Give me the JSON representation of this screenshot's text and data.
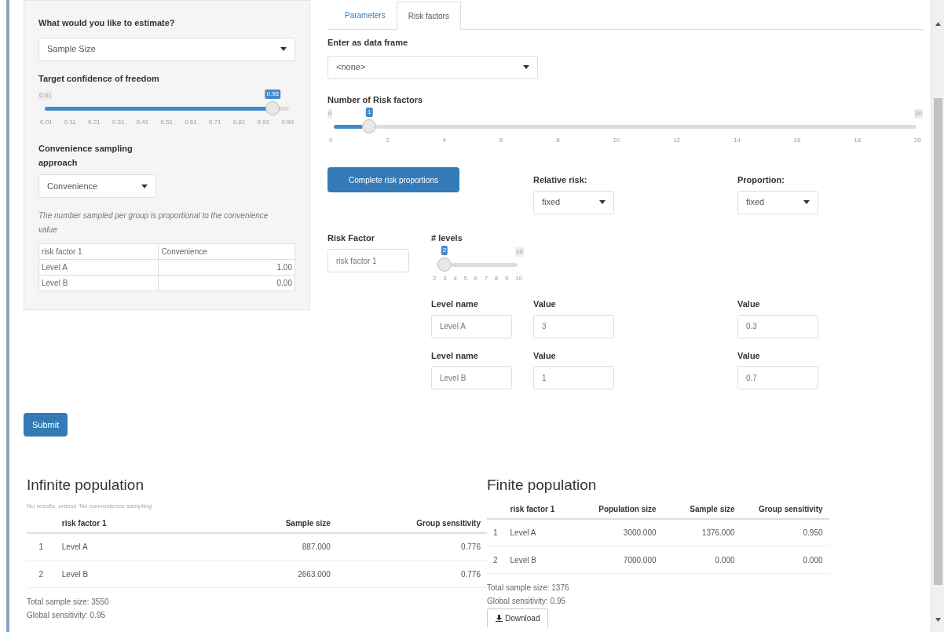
{
  "sidebar": {
    "estimate": {
      "label": "What would you like to estimate?",
      "value": "Sample Size"
    },
    "confidence": {
      "label": "Target confidence of freedom",
      "min_label": "0.01",
      "value_label": "0.95",
      "level": 0.96,
      "ticks": [
        "0.01",
        "0.11",
        "0.21",
        "0.31",
        "0.41",
        "0.51",
        "0.61",
        "0.71",
        "0.81",
        "0.91",
        "0.99"
      ]
    },
    "approach": {
      "label": "Convenience sampling approach",
      "value": "Convenience"
    },
    "note": "The number sampled per group is proportional to the convenience value",
    "table": {
      "columns": [
        "risk factor 1",
        "Convenience"
      ],
      "rows": [
        [
          "Level A",
          "1.00"
        ],
        [
          "Level B",
          "0.00"
        ]
      ]
    }
  },
  "tabs": [
    {
      "label": "Parameters",
      "selected": false
    },
    {
      "label": "Risk factors",
      "selected": true
    }
  ],
  "risk": {
    "frame": {
      "label": "Enter as data frame",
      "value": "<none>"
    },
    "count": {
      "label": "Number of Risk factors",
      "min_label": "0",
      "value_label": "1",
      "max_label": "20",
      "level": 0.05,
      "ticks": [
        "0",
        "2",
        "4",
        "6",
        "8",
        "10",
        "12",
        "14",
        "16",
        "18",
        "20"
      ]
    },
    "complete_button": "Complete risk proportions",
    "relative": {
      "label": "Relative risk:",
      "value": "fixed"
    },
    "proportion": {
      "label": "Proportion:",
      "value": "fixed"
    },
    "factor": {
      "label": "Risk Factor",
      "value": "risk factor 1"
    },
    "levels_slider": {
      "label": "# levels",
      "value_label": "2",
      "max_label": "10",
      "level": 0,
      "ticks": [
        "2",
        "3",
        "4",
        "5",
        "6",
        "7",
        "8",
        "9",
        "10"
      ]
    },
    "levels": [
      {
        "name_label": "Level name",
        "name": "Level A",
        "value_label": "Value",
        "value": "3",
        "proportion_label": "Value",
        "proportion": "0.3"
      },
      {
        "name_label": "Level name",
        "name": "Level B",
        "value_label": "Value",
        "value": "1",
        "proportion_label": "Value",
        "proportion": "0.7"
      }
    ]
  },
  "submit": "Submit",
  "infinite": {
    "title": "Infinite population",
    "note": "No results, unless 'No convenience sampling'",
    "columns": [
      "",
      "risk factor 1",
      "Sample size",
      "Group sensitivity"
    ],
    "rows": [
      [
        "1",
        "Level A",
        "887.000",
        "0.776"
      ],
      [
        "2",
        "Level B",
        "2663.000",
        "0.776"
      ]
    ],
    "summary": [
      "Total sample size: 3550",
      "Global sensitivity: 0.95"
    ]
  },
  "finite": {
    "title": "Finite population",
    "columns": [
      "",
      "risk factor 1",
      "Population size",
      "Sample size",
      "Group sensitivity"
    ],
    "rows": [
      [
        "1",
        "Level A",
        "3000.000",
        "1376.000",
        "0.950"
      ],
      [
        "2",
        "Level B",
        "7000.000",
        "0.000",
        "0.000"
      ]
    ],
    "summary": [
      "Total sample size: 1376",
      "Global sensitivity: 0.95"
    ],
    "download": "Download"
  }
}
